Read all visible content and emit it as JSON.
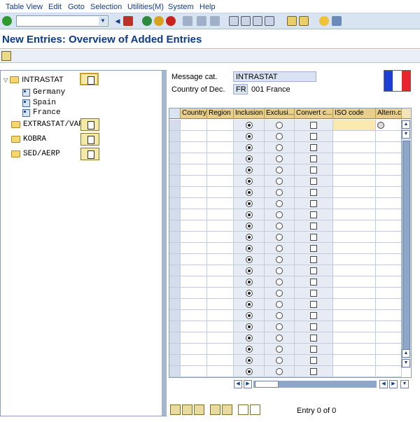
{
  "menu": [
    "Table View",
    "Edit",
    "Goto",
    "Selection",
    "Utilities(M)",
    "System",
    "Help"
  ],
  "title": "New Entries: Overview of Added Entries",
  "nav": {
    "nodes": [
      {
        "label": "INTRASTAT",
        "children": [
          "Germany",
          "Spain",
          "France"
        ]
      },
      {
        "label": "EXTRASTAT/VAR",
        "children": []
      },
      {
        "label": "KOBRA",
        "children": []
      },
      {
        "label": "SED/AERP",
        "children": []
      }
    ]
  },
  "header": {
    "message_cat_label": "Message cat.",
    "message_cat_value": "INTRASTAT",
    "country_label": "Country of Dec.",
    "country_code": "FR",
    "country_name": "001 France"
  },
  "flag_colors": [
    "#1e3fd6",
    "#ffffff",
    "#e8242e"
  ],
  "table": {
    "columns": [
      "Country",
      "Region",
      "Inclusion",
      "Exclusi...",
      "Convert c...",
      "ISO code",
      "Altern.c..."
    ],
    "row_count": 23,
    "inclusion_selected": true
  },
  "footer": {
    "entry_text": "Entry 0 of 0"
  }
}
